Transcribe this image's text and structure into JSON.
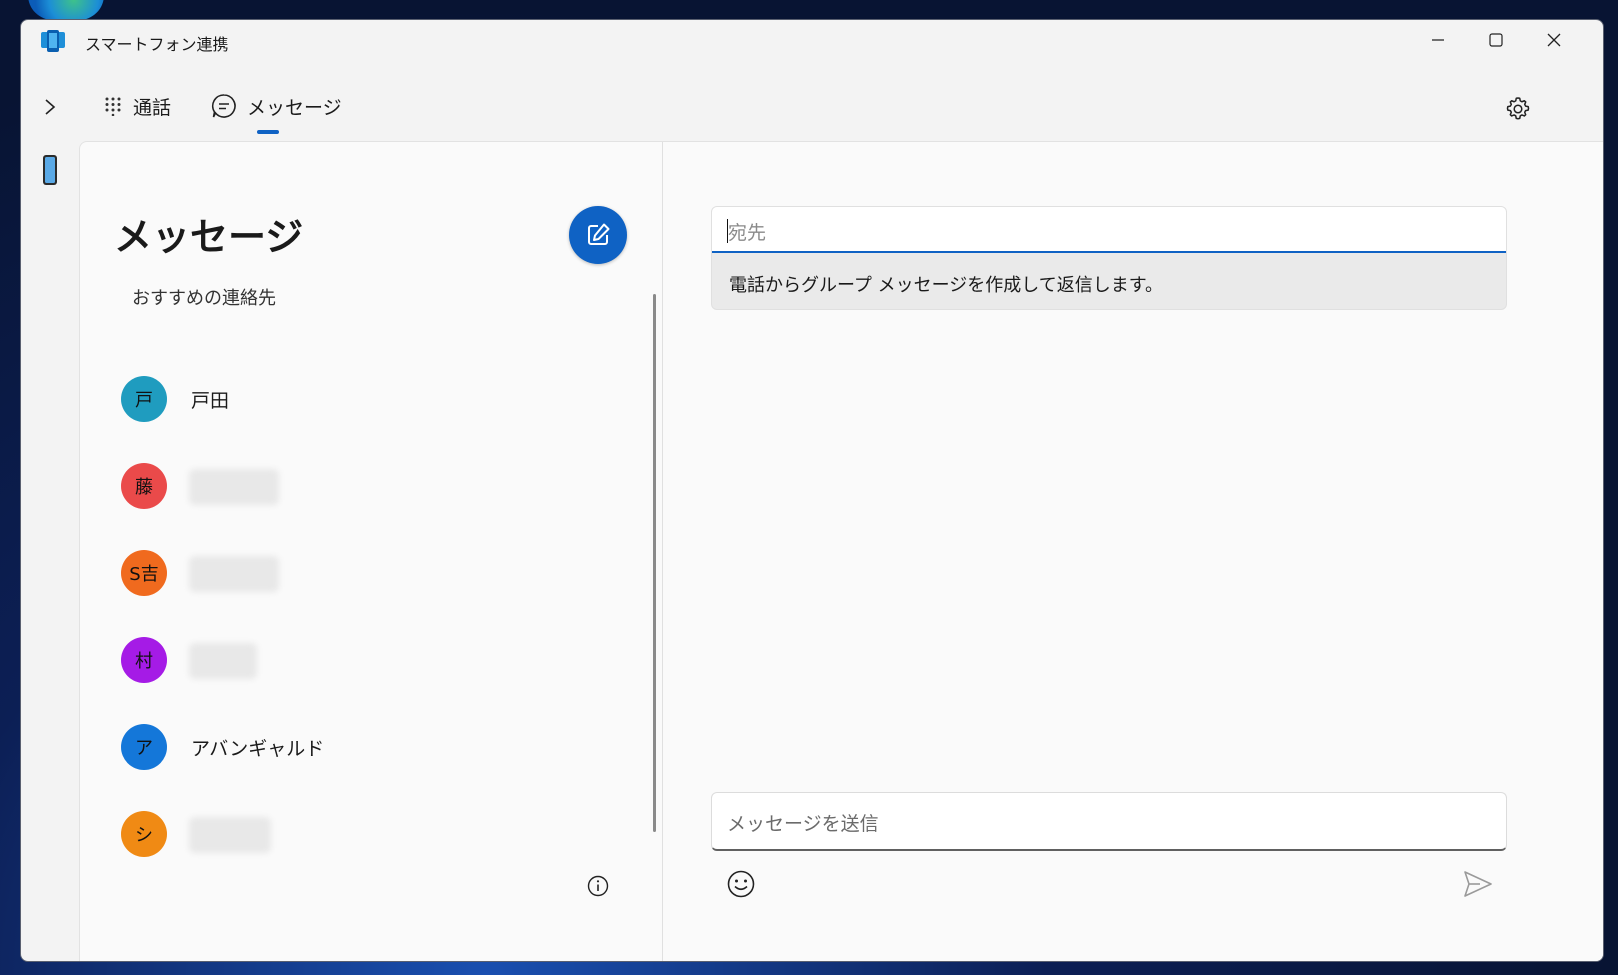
{
  "window": {
    "title": "スマートフォン連携"
  },
  "nav": {
    "tabs": [
      {
        "label": "通話",
        "icon": "dialpad-icon"
      },
      {
        "label": "メッセージ",
        "icon": "chat-bubble-icon",
        "selected": true
      }
    ]
  },
  "messages_pane": {
    "title": "メッセージ",
    "suggested_label": "おすすめの連絡先",
    "contacts": [
      {
        "initial": "戸",
        "name": "戸田",
        "color": "#1f9cbf"
      },
      {
        "initial": "藤",
        "name": "",
        "color": "#ea4a4a"
      },
      {
        "initial": "S吉",
        "name": "",
        "color": "#f06a1e"
      },
      {
        "initial": "村",
        "name": "",
        "color": "#a51be6"
      },
      {
        "initial": "ア",
        "name": "アバンギャルド",
        "color": "#1477d9"
      },
      {
        "initial": "シ",
        "name": "",
        "color": "#f08a14"
      }
    ]
  },
  "compose_pane": {
    "to_placeholder": "宛先",
    "to_hint": "電話からグループ メッセージを作成して返信します。",
    "message_placeholder": "メッセージを送信"
  },
  "colors": {
    "accent": "#0f62c4"
  }
}
